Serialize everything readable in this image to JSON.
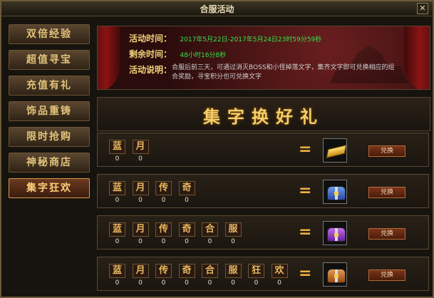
{
  "window": {
    "title": "合服活动",
    "close_label": "✕"
  },
  "sidebar": {
    "items": [
      {
        "label": "双倍经验",
        "active": false
      },
      {
        "label": "超值寻宝",
        "active": false
      },
      {
        "label": "充值有礼",
        "active": false
      },
      {
        "label": "饰品重铸",
        "active": false
      },
      {
        "label": "限时抢购",
        "active": false
      },
      {
        "label": "神秘商店",
        "active": false
      },
      {
        "label": "集字狂欢",
        "active": true
      }
    ]
  },
  "banner": {
    "time_label": "活动时间：",
    "time_value": "2017年5月22日-2017年5月24日23时59分59秒",
    "remain_label": "剩余时间：",
    "remain_value": "48小时16分8秒",
    "desc_label": "活动说明：",
    "desc_value": "合服后前三天，可通过消灭BOSS和小怪掉落文字，集齐文字即可兑换相应的组合奖励，寻宝积分也可兑换文字"
  },
  "heading": "集字换好礼",
  "rows": [
    {
      "chars": [
        "蓝",
        "月"
      ],
      "counts": [
        "0",
        "0"
      ],
      "reward_icon": "gold-bar-icon",
      "exchange_label": "兑换"
    },
    {
      "chars": [
        "蓝",
        "月",
        "传",
        "奇"
      ],
      "counts": [
        "0",
        "0",
        "0",
        "0"
      ],
      "reward_icon": "blue-chest-icon",
      "exchange_label": "兑换"
    },
    {
      "chars": [
        "蓝",
        "月",
        "传",
        "奇",
        "合",
        "服"
      ],
      "counts": [
        "0",
        "0",
        "0",
        "0",
        "0",
        "0"
      ],
      "reward_icon": "purple-chest-icon",
      "exchange_label": "兑换"
    },
    {
      "chars": [
        "蓝",
        "月",
        "传",
        "奇",
        "合",
        "服",
        "狂",
        "欢"
      ],
      "counts": [
        "0",
        "0",
        "0",
        "0",
        "0",
        "0",
        "0",
        "0"
      ],
      "reward_icon": "orange-chest-icon",
      "exchange_label": "兑换"
    }
  ]
}
